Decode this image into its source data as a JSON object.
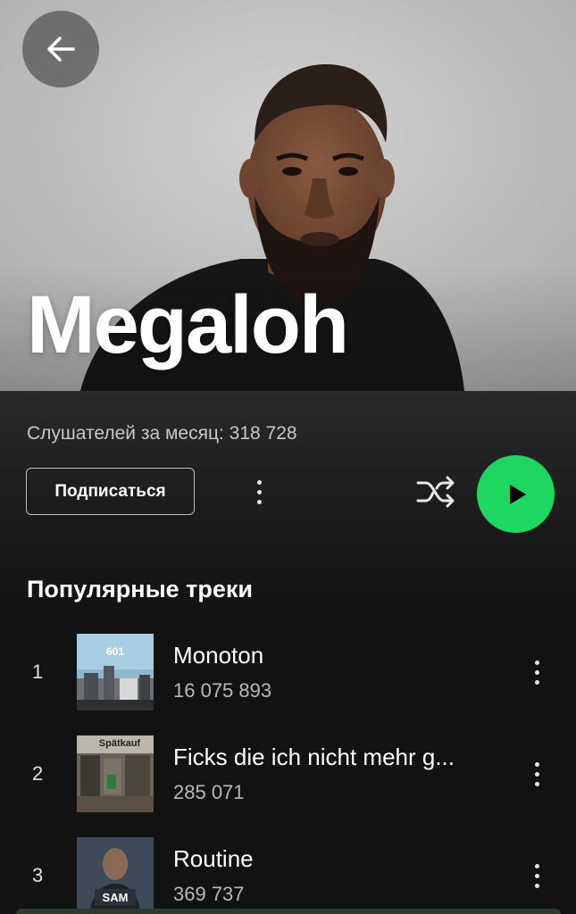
{
  "artist": {
    "name": "Megaloh",
    "monthly_listeners": "Слушателей за месяц: 318 728"
  },
  "actions": {
    "follow_label": "Подписаться",
    "more_icon": "more-vertical-icon",
    "shuffle_icon": "shuffle-icon",
    "play_icon": "play-icon"
  },
  "nav": {
    "back_icon": "back-arrow-icon"
  },
  "popular": {
    "title": "Популярные треки",
    "tracks": [
      {
        "number": "1",
        "title": "Monoton",
        "plays": "16 075 893",
        "cover_text": "601"
      },
      {
        "number": "2",
        "title": "Ficks die ich nicht mehr g...",
        "plays": "285 071",
        "cover_text": "Spätkauf"
      },
      {
        "number": "3",
        "title": "Routine",
        "plays": "369 737",
        "cover_text": "SAM"
      }
    ]
  },
  "colors": {
    "accent": "#1ed760",
    "background": "#121212",
    "text_secondary": "#b8b8b8"
  }
}
